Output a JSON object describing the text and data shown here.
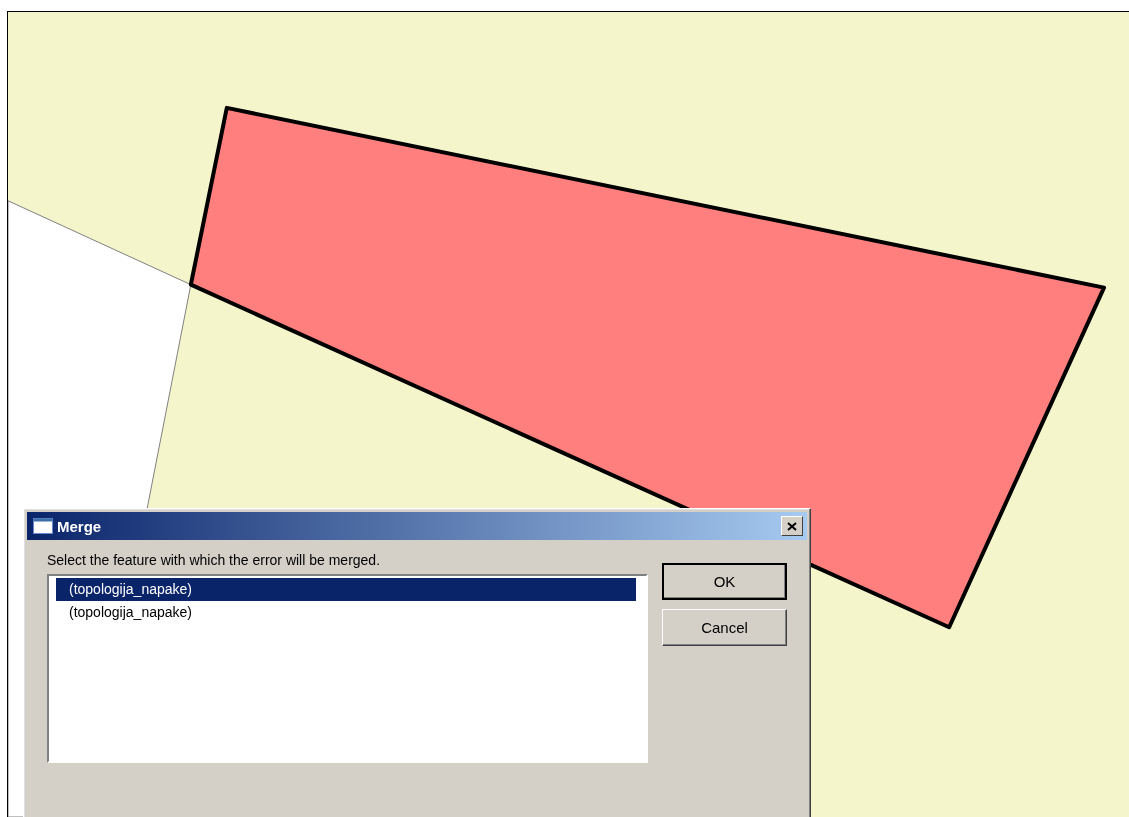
{
  "dialog": {
    "title": "Merge",
    "message": "Select the feature with which the error will be merged.",
    "items": [
      {
        "label": "(topologija_napake)",
        "selected": true
      },
      {
        "label": "(topologija_napake)",
        "selected": false
      }
    ],
    "buttons": [
      {
        "label": "OK",
        "kind": "default"
      },
      {
        "label": "Cancel",
        "kind": "normal"
      }
    ]
  }
}
